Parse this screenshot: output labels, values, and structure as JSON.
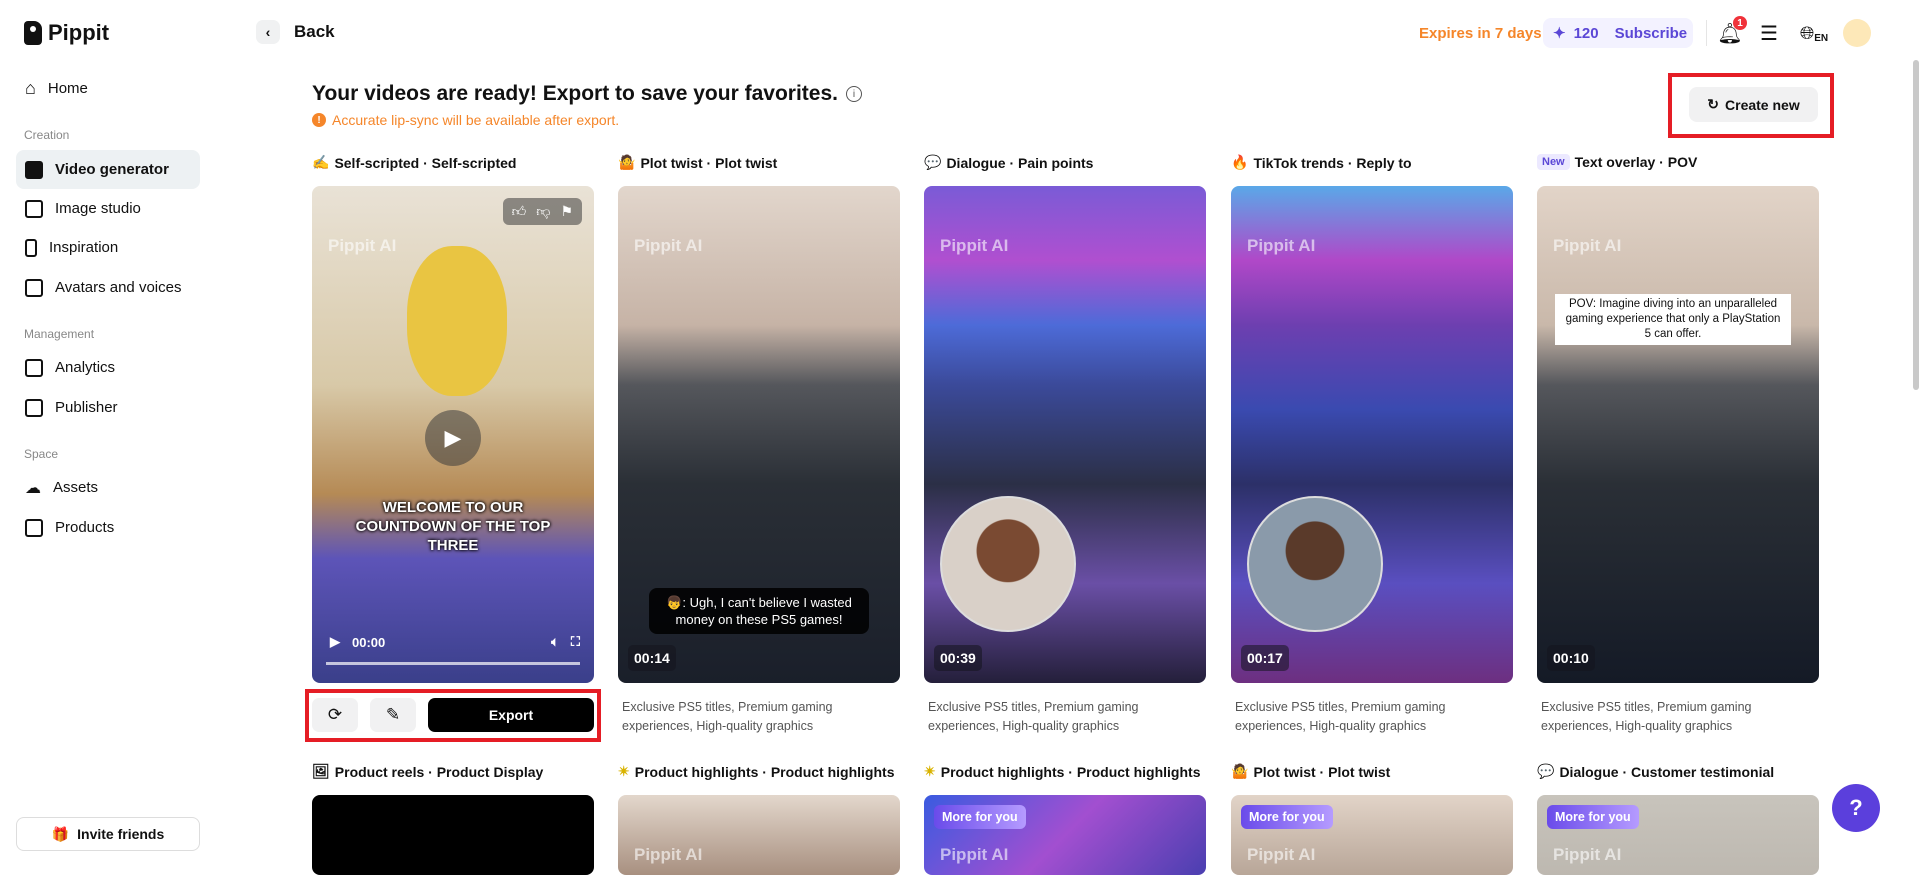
{
  "app": {
    "name": "Pippit"
  },
  "sidebar": {
    "home": "Home",
    "sections": {
      "creation": "Creation",
      "management": "Management",
      "space": "Space"
    },
    "items": [
      "Video generator",
      "Image studio",
      "Inspiration",
      "Avatars and voices",
      "Analytics",
      "Publisher",
      "Assets",
      "Products"
    ],
    "invite": "Invite friends"
  },
  "header": {
    "back": "Back",
    "expires": "Expires in 7 days",
    "credits": "120",
    "subscribe": "Subscribe",
    "notif_count": "1",
    "lang": "EN"
  },
  "main": {
    "title": "Your videos are ready! Export to save your favorites.",
    "warning": "Accurate lip-sync will be available after export.",
    "create_new": "Create new",
    "watermark": "Pippit AI",
    "export": "Export",
    "more_for_you": "More for you",
    "new_tag": "New",
    "row1": [
      {
        "icon": "✍",
        "label": "Self-scripted · Self-scripted",
        "time": "00:00",
        "caption": "WELCOME TO OUR COUNTDOWN OF THE TOP THREE"
      },
      {
        "icon": "🤷",
        "label": "Plot twist · Plot twist",
        "time": "00:14",
        "caption": "👦: Ugh, I can't believe I wasted money on these PS5 games!",
        "desc": "Exclusive PS5 titles, Premium gaming experiences, High-quality graphics"
      },
      {
        "icon": "💬",
        "label": "Dialogue · Pain points",
        "time": "00:39",
        "desc": "Exclusive PS5 titles, Premium gaming experiences, High-quality graphics"
      },
      {
        "icon": "🔥",
        "label": "TikTok trends · Reply to",
        "time": "00:17",
        "desc": "Exclusive PS5 titles, Premium gaming experiences, High-quality graphics"
      },
      {
        "icon": "",
        "label": "Text overlay · POV",
        "time": "00:10",
        "caption": "POV: Imagine diving into an unparalleled gaming experience that only a PlayStation 5 can offer.",
        "desc": "Exclusive PS5 titles, Premium gaming experiences, High-quality graphics"
      }
    ],
    "row2": [
      {
        "icon": "🖼",
        "label": "Product reels · Product Display"
      },
      {
        "icon": "✴",
        "label": "Product highlights · Product highlights"
      },
      {
        "icon": "✴",
        "label": "Product highlights · Product highlights"
      },
      {
        "icon": "🤷",
        "label": "Plot twist · Plot twist"
      },
      {
        "icon": "💬",
        "label": "Dialogue · Customer testimonial"
      }
    ]
  },
  "colors": {
    "accent": "#5b47d6",
    "warning": "#f5862a",
    "highlight": "#e51d25"
  }
}
